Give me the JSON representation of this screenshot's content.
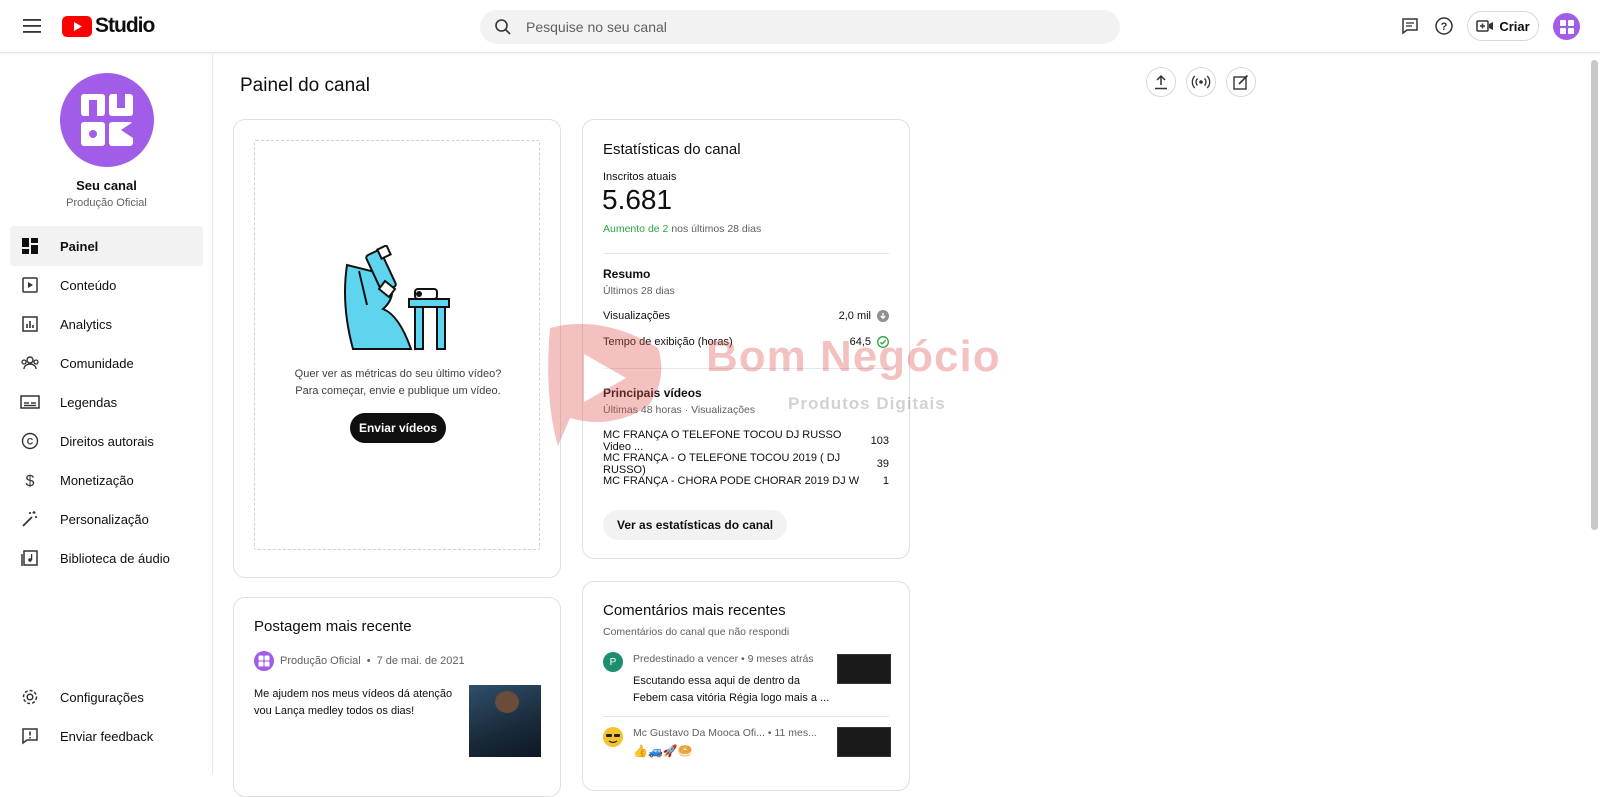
{
  "header": {
    "logo_text": "Studio",
    "search_placeholder": "Pesquise no seu canal",
    "create_label": "Criar"
  },
  "sidebar": {
    "channel_name": "Seu canal",
    "channel_sub": "Produção Oficial",
    "items": [
      {
        "label": "Painel",
        "icon": "dashboard-icon",
        "active": true
      },
      {
        "label": "Conteúdo",
        "icon": "content-icon"
      },
      {
        "label": "Analytics",
        "icon": "analytics-icon"
      },
      {
        "label": "Comunidade",
        "icon": "community-icon"
      },
      {
        "label": "Legendas",
        "icon": "subtitles-icon"
      },
      {
        "label": "Direitos autorais",
        "icon": "copyright-icon"
      },
      {
        "label": "Monetização",
        "icon": "dollar-icon"
      },
      {
        "label": "Personalização",
        "icon": "magic-wand-icon"
      },
      {
        "label": "Biblioteca de áudio",
        "icon": "audio-library-icon"
      }
    ],
    "bottom": [
      {
        "label": "Configurações",
        "icon": "gear-icon"
      },
      {
        "label": "Enviar feedback",
        "icon": "feedback-icon"
      }
    ]
  },
  "main": {
    "title": "Painel do canal",
    "upload_card": {
      "message_line1": "Quer ver as métricas do seu último vídeo?",
      "message_line2": "Para começar, envie e publique um vídeo.",
      "button": "Enviar vídeos"
    },
    "stats": {
      "title": "Estatísticas do canal",
      "subs_label": "Inscritos atuais",
      "subs_value": "5.681",
      "increase_green": "Aumento de 2",
      "increase_rest": "nos últimos 28 dias",
      "summary_title": "Resumo",
      "summary_period": "Últimos 28 dias",
      "views_label": "Visualizações",
      "views_value": "2,0 mil",
      "watch_label": "Tempo de exibição (horas)",
      "watch_value": "64,5",
      "top_title": "Principais vídeos",
      "top_period": "Últimas 48 horas · Visualizações",
      "top_videos": [
        {
          "title": "MC FRANÇA O TELEFONE TOCOU DJ RUSSO Video ...",
          "views": "103"
        },
        {
          "title": "MC FRANÇA - O TELEFONE TOCOU 2019 ( DJ RUSSO)",
          "views": "39"
        },
        {
          "title": "MC FRANÇA - CHORA PODE CHORAR 2019 DJ W",
          "views": "1"
        }
      ],
      "button": "Ver as estatísticas do canal"
    },
    "post": {
      "title": "Postagem mais recente",
      "author": "Produção Oficial",
      "date": "7 de mai. de 2021",
      "text_line1": "Me ajudem nos meus vídeos dá atenção",
      "text_line2": "vou Lança medley todos os dias!"
    },
    "comments": {
      "title": "Comentários mais recentes",
      "subtitle": "Comentários do canal que não respondi",
      "items": [
        {
          "author": "Predestinado a vencer",
          "time": "9 meses atrás",
          "line1": "Escutando essa aqui de dentro da",
          "line2": "Febem casa vitória Régia logo mais a ...",
          "avatar_letter": "P"
        },
        {
          "author": "Mc Gustavo Da Mooca Ofi...",
          "time": "11 mes...",
          "line1": "👍🚙🚀🥯"
        }
      ]
    }
  },
  "watermark": {
    "line1": "Bom Negócio",
    "line2": "Produtos Digitais"
  },
  "colors": {
    "accent": "#a15ce8",
    "green": "#2ba640",
    "youtube_red": "#ff0000"
  }
}
